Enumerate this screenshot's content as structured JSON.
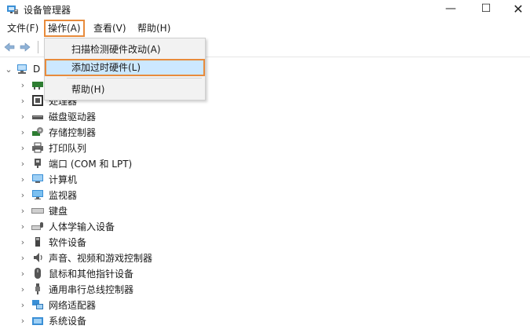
{
  "window": {
    "title": "设备管理器",
    "minimize": "—",
    "maximize": "☐",
    "close": "✕"
  },
  "menubar": [
    {
      "label": "文件(F)",
      "highlighted": false
    },
    {
      "label": "操作(A)",
      "highlighted": true
    },
    {
      "label": "查看(V)",
      "highlighted": false
    },
    {
      "label": "帮助(H)",
      "highlighted": false
    }
  ],
  "toolbar": {
    "back_icon": "arrow-left-icon",
    "forward_icon": "arrow-right-icon"
  },
  "dropdown": {
    "items": [
      {
        "label": "扫描检测硬件改动(A)",
        "selected": false
      },
      {
        "label": "添加过时硬件(L)",
        "selected": true
      },
      {
        "label": "帮助(H)",
        "selected": false
      }
    ]
  },
  "tree": {
    "root": {
      "label": "D",
      "expanded": true
    },
    "items": [
      {
        "label": "",
        "icon": "display-adapter-icon"
      },
      {
        "label": "处理器",
        "icon": "processor-icon"
      },
      {
        "label": "磁盘驱动器",
        "icon": "disk-drive-icon"
      },
      {
        "label": "存储控制器",
        "icon": "storage-controller-icon"
      },
      {
        "label": "打印队列",
        "icon": "printer-icon"
      },
      {
        "label": "端口 (COM 和 LPT)",
        "icon": "port-icon"
      },
      {
        "label": "计算机",
        "icon": "computer-icon"
      },
      {
        "label": "监视器",
        "icon": "monitor-icon"
      },
      {
        "label": "键盘",
        "icon": "keyboard-icon"
      },
      {
        "label": "人体学输入设备",
        "icon": "hid-icon"
      },
      {
        "label": "软件设备",
        "icon": "software-device-icon"
      },
      {
        "label": "声音、视频和游戏控制器",
        "icon": "speaker-icon"
      },
      {
        "label": "鼠标和其他指针设备",
        "icon": "mouse-icon"
      },
      {
        "label": "通用串行总线控制器",
        "icon": "usb-icon"
      },
      {
        "label": "网络适配器",
        "icon": "network-adapter-icon"
      },
      {
        "label": "系统设备",
        "icon": "system-device-icon"
      }
    ]
  },
  "colors": {
    "highlight_border": "#e88b3c",
    "selection_bg": "#cce8ff",
    "icon_blue": "#3a8fd6"
  }
}
